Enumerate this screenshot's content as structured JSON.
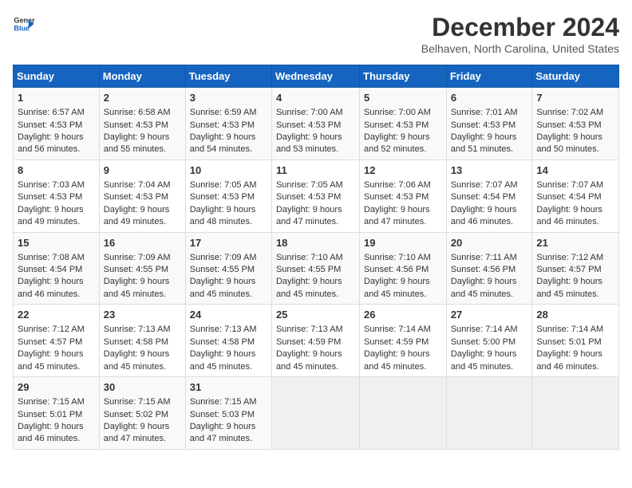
{
  "logo": {
    "line1": "General",
    "line2": "Blue",
    "arrow_color": "#1565c0"
  },
  "title": "December 2024",
  "subtitle": "Belhaven, North Carolina, United States",
  "header_days": [
    "Sunday",
    "Monday",
    "Tuesday",
    "Wednesday",
    "Thursday",
    "Friday",
    "Saturday"
  ],
  "weeks": [
    [
      {
        "day": "1",
        "rise": "6:57 AM",
        "set": "4:53 PM",
        "daylight": "9 hours and 56 minutes."
      },
      {
        "day": "2",
        "rise": "6:58 AM",
        "set": "4:53 PM",
        "daylight": "9 hours and 55 minutes."
      },
      {
        "day": "3",
        "rise": "6:59 AM",
        "set": "4:53 PM",
        "daylight": "9 hours and 54 minutes."
      },
      {
        "day": "4",
        "rise": "7:00 AM",
        "set": "4:53 PM",
        "daylight": "9 hours and 53 minutes."
      },
      {
        "day": "5",
        "rise": "7:00 AM",
        "set": "4:53 PM",
        "daylight": "9 hours and 52 minutes."
      },
      {
        "day": "6",
        "rise": "7:01 AM",
        "set": "4:53 PM",
        "daylight": "9 hours and 51 minutes."
      },
      {
        "day": "7",
        "rise": "7:02 AM",
        "set": "4:53 PM",
        "daylight": "9 hours and 50 minutes."
      }
    ],
    [
      {
        "day": "8",
        "rise": "7:03 AM",
        "set": "4:53 PM",
        "daylight": "9 hours and 49 minutes."
      },
      {
        "day": "9",
        "rise": "7:04 AM",
        "set": "4:53 PM",
        "daylight": "9 hours and 49 minutes."
      },
      {
        "day": "10",
        "rise": "7:05 AM",
        "set": "4:53 PM",
        "daylight": "9 hours and 48 minutes."
      },
      {
        "day": "11",
        "rise": "7:05 AM",
        "set": "4:53 PM",
        "daylight": "9 hours and 47 minutes."
      },
      {
        "day": "12",
        "rise": "7:06 AM",
        "set": "4:53 PM",
        "daylight": "9 hours and 47 minutes."
      },
      {
        "day": "13",
        "rise": "7:07 AM",
        "set": "4:54 PM",
        "daylight": "9 hours and 46 minutes."
      },
      {
        "day": "14",
        "rise": "7:07 AM",
        "set": "4:54 PM",
        "daylight": "9 hours and 46 minutes."
      }
    ],
    [
      {
        "day": "15",
        "rise": "7:08 AM",
        "set": "4:54 PM",
        "daylight": "9 hours and 46 minutes."
      },
      {
        "day": "16",
        "rise": "7:09 AM",
        "set": "4:55 PM",
        "daylight": "9 hours and 45 minutes."
      },
      {
        "day": "17",
        "rise": "7:09 AM",
        "set": "4:55 PM",
        "daylight": "9 hours and 45 minutes."
      },
      {
        "day": "18",
        "rise": "7:10 AM",
        "set": "4:55 PM",
        "daylight": "9 hours and 45 minutes."
      },
      {
        "day": "19",
        "rise": "7:10 AM",
        "set": "4:56 PM",
        "daylight": "9 hours and 45 minutes."
      },
      {
        "day": "20",
        "rise": "7:11 AM",
        "set": "4:56 PM",
        "daylight": "9 hours and 45 minutes."
      },
      {
        "day": "21",
        "rise": "7:12 AM",
        "set": "4:57 PM",
        "daylight": "9 hours and 45 minutes."
      }
    ],
    [
      {
        "day": "22",
        "rise": "7:12 AM",
        "set": "4:57 PM",
        "daylight": "9 hours and 45 minutes."
      },
      {
        "day": "23",
        "rise": "7:13 AM",
        "set": "4:58 PM",
        "daylight": "9 hours and 45 minutes."
      },
      {
        "day": "24",
        "rise": "7:13 AM",
        "set": "4:58 PM",
        "daylight": "9 hours and 45 minutes."
      },
      {
        "day": "25",
        "rise": "7:13 AM",
        "set": "4:59 PM",
        "daylight": "9 hours and 45 minutes."
      },
      {
        "day": "26",
        "rise": "7:14 AM",
        "set": "4:59 PM",
        "daylight": "9 hours and 45 minutes."
      },
      {
        "day": "27",
        "rise": "7:14 AM",
        "set": "5:00 PM",
        "daylight": "9 hours and 45 minutes."
      },
      {
        "day": "28",
        "rise": "7:14 AM",
        "set": "5:01 PM",
        "daylight": "9 hours and 46 minutes."
      }
    ],
    [
      {
        "day": "29",
        "rise": "7:15 AM",
        "set": "5:01 PM",
        "daylight": "9 hours and 46 minutes."
      },
      {
        "day": "30",
        "rise": "7:15 AM",
        "set": "5:02 PM",
        "daylight": "9 hours and 47 minutes."
      },
      {
        "day": "31",
        "rise": "7:15 AM",
        "set": "5:03 PM",
        "daylight": "9 hours and 47 minutes."
      },
      null,
      null,
      null,
      null
    ]
  ],
  "labels": {
    "sunrise": "Sunrise:",
    "sunset": "Sunset:",
    "daylight": "Daylight:"
  }
}
